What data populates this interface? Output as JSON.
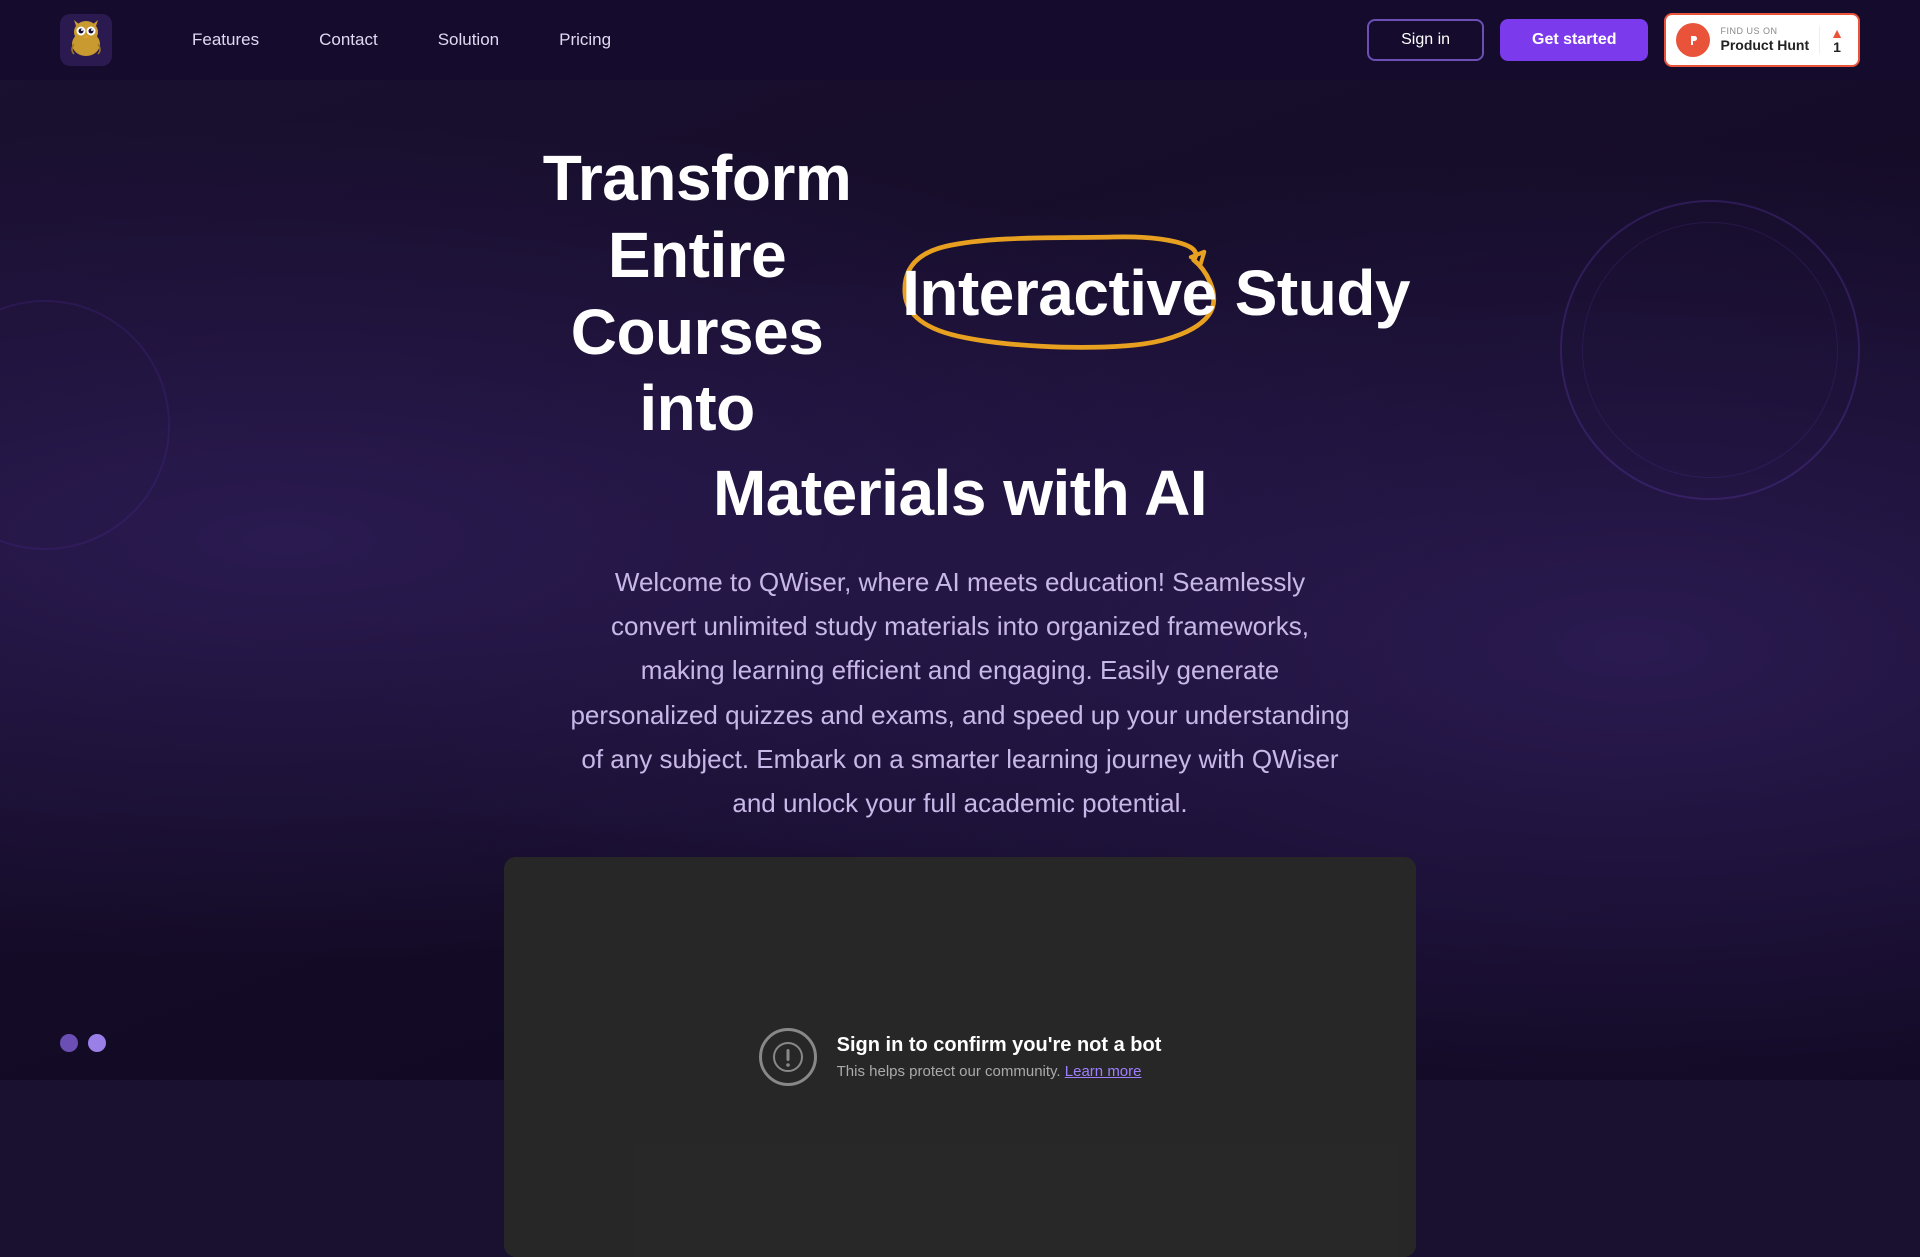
{
  "nav": {
    "logo_alt": "QWiser Logo",
    "links": [
      {
        "label": "Features",
        "id": "features"
      },
      {
        "label": "Contact",
        "id": "contact"
      },
      {
        "label": "Solution",
        "id": "solution"
      },
      {
        "label": "Pricing",
        "id": "pricing"
      }
    ],
    "signin_label": "Sign in",
    "getstarted_label": "Get started",
    "producthunt": {
      "find_text": "FIND US ON",
      "name": "Product Hunt",
      "count": "1",
      "arrow": "▲"
    }
  },
  "hero": {
    "title_part1": "Transform Entire Courses into",
    "title_highlight": "Interactive",
    "title_part2": "Study",
    "title_line2": "Materials with AI",
    "subtitle": "Welcome to QWiser, where AI meets education! Seamlessly convert unlimited study materials into organized frameworks, making learning efficient and engaging. Easily generate personalized quizzes and exams, and speed up your understanding of any subject. Embark on a smarter learning journey with QWiser and unlock your full academic potential."
  },
  "bot_protection": {
    "title": "Sign in to confirm you're not a bot",
    "description": "This helps protect our community.",
    "link_text": "Learn more"
  },
  "dots": [
    {
      "active": false
    },
    {
      "active": true
    }
  ]
}
